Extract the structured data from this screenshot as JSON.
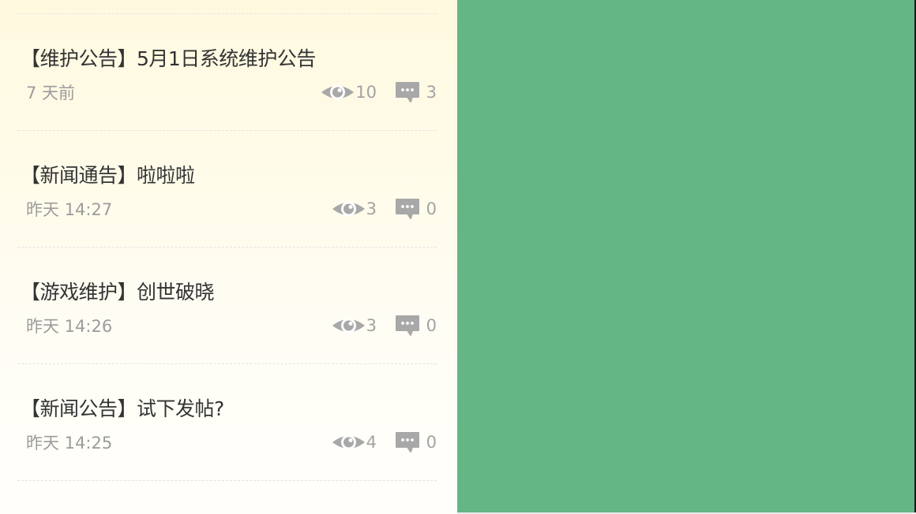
{
  "posts": [
    {
      "title": "【维护公告】5月1日系统维护公告",
      "time": "7 天前",
      "views": "10",
      "comments": "3"
    },
    {
      "title": "【新闻通告】啦啦啦",
      "time": "昨天 14:27",
      "views": "3",
      "comments": "0"
    },
    {
      "title": "【游戏维护】创世破晓",
      "time": "昨天 14:26",
      "views": "3",
      "comments": "0"
    },
    {
      "title": "【新闻公告】试下发帖?",
      "time": "昨天 14:25",
      "views": "4",
      "comments": "0"
    }
  ],
  "icons": {
    "views": "eye-icon",
    "comments": "comment-icon"
  },
  "colors": {
    "panel_green": "#65b685",
    "icon_gray": "#a8a8a8",
    "title_text": "#333333",
    "meta_text": "#9c9c9c"
  }
}
